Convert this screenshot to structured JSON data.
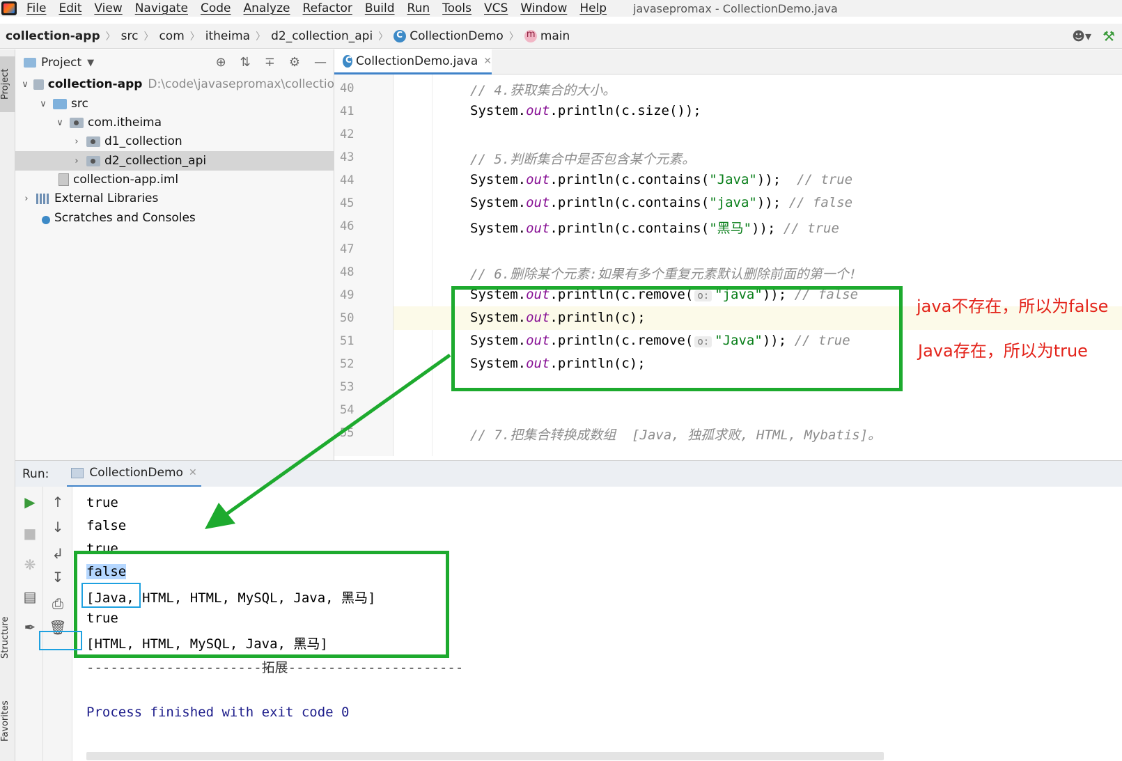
{
  "menubar": {
    "items": [
      "File",
      "Edit",
      "View",
      "Navigate",
      "Code",
      "Analyze",
      "Refactor",
      "Build",
      "Run",
      "Tools",
      "VCS",
      "Window",
      "Help"
    ],
    "window_title": "javasepromax - CollectionDemo.java"
  },
  "breadcrumb": {
    "project": "collection-app",
    "segments": [
      "src",
      "com",
      "itheima",
      "d2_collection_api"
    ],
    "class": "CollectionDemo",
    "method": "main"
  },
  "left_strip": {
    "project": "Project",
    "structure": "Structure",
    "favorites": "Favorites"
  },
  "project_panel": {
    "title": "Project",
    "tree": [
      {
        "label": "collection-app",
        "path": "D:\\code\\javasepromax\\collectio"
      },
      {
        "label": "src"
      },
      {
        "label": "com.itheima"
      },
      {
        "label": "d1_collection"
      },
      {
        "label": "d2_collection_api"
      },
      {
        "label": "collection-app.iml"
      },
      {
        "label": "External Libraries"
      },
      {
        "label": "Scratches and Consoles"
      }
    ]
  },
  "editor": {
    "tab_label": "CollectionDemo.java",
    "line_numbers": [
      "40",
      "41",
      "42",
      "43",
      "44",
      "45",
      "46",
      "47",
      "48",
      "49",
      "50",
      "51",
      "52",
      "53",
      "54",
      "55"
    ],
    "current_line": "50",
    "code": {
      "l40_comment": "// 4.获取集合的大小。",
      "l41_a": "System.",
      "l41_out": "out",
      "l41_b": ".println(c.size());",
      "l43_comment": "// 5.判断集合中是否包含某个元素。",
      "l44_a": "System.",
      "l44_out": "out",
      "l44_b": ".println(c.contains(",
      "l44_str": "\"Java\"",
      "l44_c": "));  ",
      "l44_comment": "// true",
      "l45_a": "System.",
      "l45_out": "out",
      "l45_b": ".println(c.contains(",
      "l45_str": "\"java\"",
      "l45_c": ")); ",
      "l45_comment": "// false",
      "l46_a": "System.",
      "l46_out": "out",
      "l46_b": ".println(c.contains(",
      "l46_str": "\"黑马\"",
      "l46_c": ")); ",
      "l46_comment": "// true",
      "l48_comment": "// 6.删除某个元素:如果有多个重复元素默认删除前面的第一个!",
      "l49_a": "System.",
      "l49_out": "out",
      "l49_b": ".println(c.remove(",
      "l49_hint": "o:",
      "l49_str": "\"java\"",
      "l49_c": ")); ",
      "l49_comment": "// false",
      "l50_a": "System.",
      "l50_out": "out",
      "l50_b": ".println(c);",
      "l51_a": "System.",
      "l51_out": "out",
      "l51_b": ".println(c.remove(",
      "l51_hint": "o:",
      "l51_str": "\"Java\"",
      "l51_c": ")); ",
      "l51_comment": "// true",
      "l52_a": "System.",
      "l52_out": "out",
      "l52_b": ".println(c);",
      "l55_comment": "// 7.把集合转换成数组  [Java, 独孤求败, HTML, Mybatis]。"
    }
  },
  "annotations": {
    "note1": "java不存在，所以为false",
    "note2": "Java存在，所以为true",
    "colors": {
      "note": "#e3231a",
      "box": "#1daa2e",
      "highlight": "#1ea1e0"
    }
  },
  "run_panel": {
    "label": "Run:",
    "tab_label": "CollectionDemo",
    "output": [
      "true",
      "false",
      "true",
      "false",
      "[Java, HTML, HTML, MySQL, Java, 黑马]",
      "true",
      "[HTML, HTML, MySQL, Java, 黑马]",
      "----------------------拓展----------------------",
      "",
      "Process finished with exit code 0"
    ]
  }
}
